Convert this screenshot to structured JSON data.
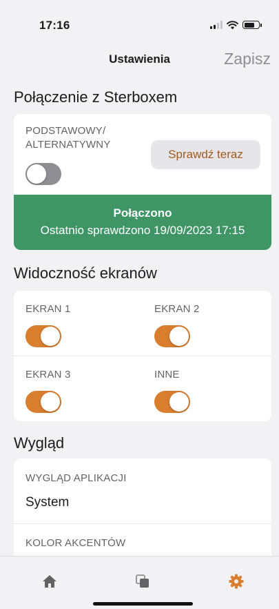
{
  "status_bar": {
    "time": "17:16"
  },
  "nav": {
    "title": "Ustawienia",
    "save": "Zapisz"
  },
  "connection": {
    "section_title": "Połączenie z Sterboxem",
    "mode_label": "PODSTAWOWY/\nALTERNATYWNY",
    "mode_toggle_on": false,
    "check_button": "Sprawdź teraz",
    "status_title": "Połączono",
    "status_detail": "Ostatnio sprawdzono 19/09/2023 17:15"
  },
  "screens": {
    "section_title": "Widoczność ekranów",
    "items": [
      {
        "label": "EKRAN 1",
        "on": true
      },
      {
        "label": "EKRAN 2",
        "on": true
      },
      {
        "label": "EKRAN 3",
        "on": true
      },
      {
        "label": "INNE",
        "on": true
      }
    ]
  },
  "appearance": {
    "section_title": "Wygląd",
    "app_look_label": "WYGLĄD APLIKACJI",
    "app_look_value": "System",
    "accent_label": "KOLOR AKCENTÓW"
  },
  "tab_bar": {
    "items": [
      {
        "icon": "home-icon",
        "active": false
      },
      {
        "icon": "copy-icon",
        "active": false
      },
      {
        "icon": "gear-icon",
        "active": true
      }
    ]
  },
  "colors": {
    "accent": "#d97d2e",
    "success": "#3f9566",
    "button_text": "#a35a1b"
  }
}
